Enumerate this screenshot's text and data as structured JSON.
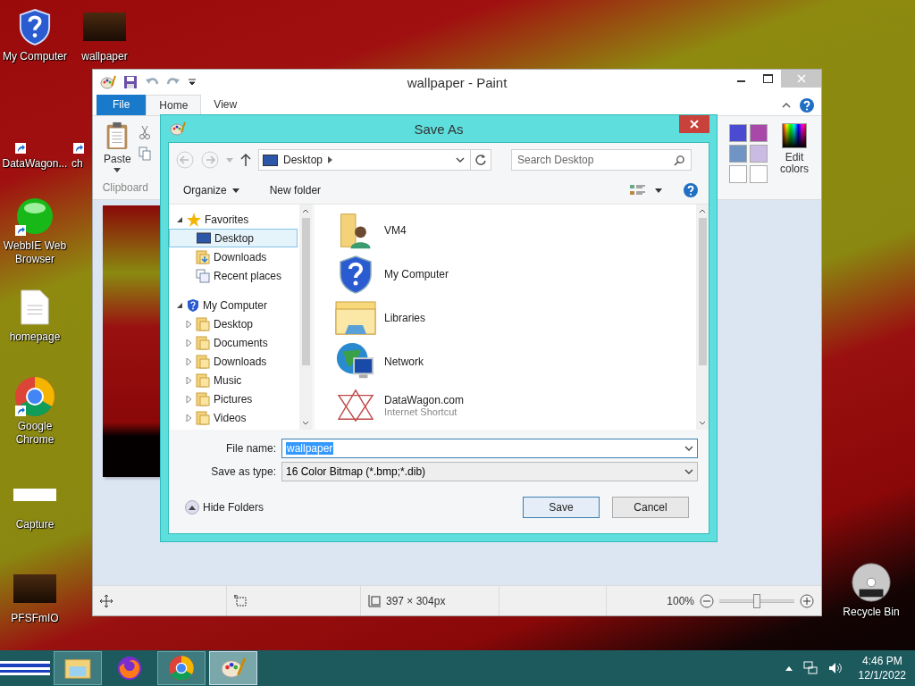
{
  "desktop": {
    "icons": [
      {
        "label": "My Computer",
        "kind": "shield",
        "shortcut": false
      },
      {
        "label": "wallpaper",
        "kind": "image",
        "shortcut": false
      },
      {
        "label": "DataWagon...",
        "kind": "blank",
        "shortcut": true
      },
      {
        "label": "ch",
        "kind": "blank",
        "shortcut": true
      },
      {
        "label": "WebbIE Web Browser",
        "kind": "orb",
        "shortcut": true
      },
      {
        "label": "homepage",
        "kind": "document",
        "shortcut": false
      },
      {
        "label": "Google Chrome",
        "kind": "chrome",
        "shortcut": true
      },
      {
        "label": "Capture",
        "kind": "thumb",
        "shortcut": false
      },
      {
        "label": "PFSFmIO",
        "kind": "image",
        "shortcut": false
      },
      {
        "label": "Recycle Bin",
        "kind": "disc",
        "shortcut": false
      }
    ]
  },
  "paint": {
    "title": "wallpaper - Paint",
    "tabs": [
      {
        "label": "File",
        "kind": "menu",
        "selected": false
      },
      {
        "label": "Home",
        "kind": "tab",
        "selected": true
      },
      {
        "label": "View",
        "kind": "tab",
        "selected": false
      }
    ],
    "ribbon": {
      "paste": "Paste",
      "group": "Clipboard",
      "edit_colors": "Edit colors",
      "palette": [
        {
          "color": "#4b4bd2"
        },
        {
          "color": "#a848a8"
        },
        {
          "color": "#7094c4"
        },
        {
          "color": "#cabbe2"
        },
        {
          "color": "#ffffff"
        },
        {
          "color": "#ffffff"
        }
      ]
    },
    "status": {
      "size": "397 × 304px",
      "zoom": "100%",
      "zoom_slider": {
        "level": 0.5
      }
    }
  },
  "dialog": {
    "title": "Save As",
    "address": "Desktop",
    "search": {
      "placeholder": "Search Desktop"
    },
    "toolbar": [
      "Organize",
      "New folder"
    ],
    "tree": [
      {
        "label": "Favorites",
        "kind": "star",
        "expanded": true,
        "children": [
          {
            "label": "Desktop",
            "kind": "desktop",
            "selected": true
          },
          {
            "label": "Downloads",
            "kind": "downloads",
            "selected": false
          },
          {
            "label": "Recent places",
            "kind": "recent",
            "selected": false
          }
        ]
      },
      {
        "label": "My Computer",
        "kind": "shield",
        "expanded": true,
        "children": [
          {
            "label": "Desktop",
            "kind": "folder",
            "selected": false,
            "expanded": false
          },
          {
            "label": "Documents",
            "kind": "folder",
            "selected": false,
            "expanded": false
          },
          {
            "label": "Downloads",
            "kind": "folder",
            "selected": false,
            "expanded": false
          },
          {
            "label": "Music",
            "kind": "folder",
            "selected": false,
            "expanded": false
          },
          {
            "label": "Pictures",
            "kind": "folder",
            "selected": false,
            "expanded": false
          },
          {
            "label": "Videos",
            "kind": "folder",
            "selected": false,
            "expanded": false
          }
        ]
      }
    ],
    "items": [
      {
        "label": "VM4",
        "kind": "user"
      },
      {
        "label": "My Computer",
        "kind": "shield"
      },
      {
        "label": "Libraries",
        "kind": "libraries"
      },
      {
        "label": "Network",
        "kind": "network"
      },
      {
        "label": "DataWagon.com",
        "sub": "Internet Shortcut",
        "kind": "web"
      }
    ],
    "file_name_label": "File name:",
    "file_name": "wallpaper",
    "type_label": "Save as type:",
    "type": "16 Color Bitmap (*.bmp;*.dib)",
    "hide_folders": "Hide Folders",
    "buttons": [
      "Save",
      "Cancel"
    ]
  },
  "taskbar": {
    "apps": [
      {
        "kind": "explorer",
        "running": true,
        "selected": false
      },
      {
        "kind": "firefox",
        "running": false,
        "selected": false
      },
      {
        "kind": "chrome",
        "running": true,
        "selected": false
      },
      {
        "kind": "paint",
        "running": true,
        "selected": true
      }
    ],
    "time": "4:46 PM",
    "date": "12/1/2022"
  }
}
